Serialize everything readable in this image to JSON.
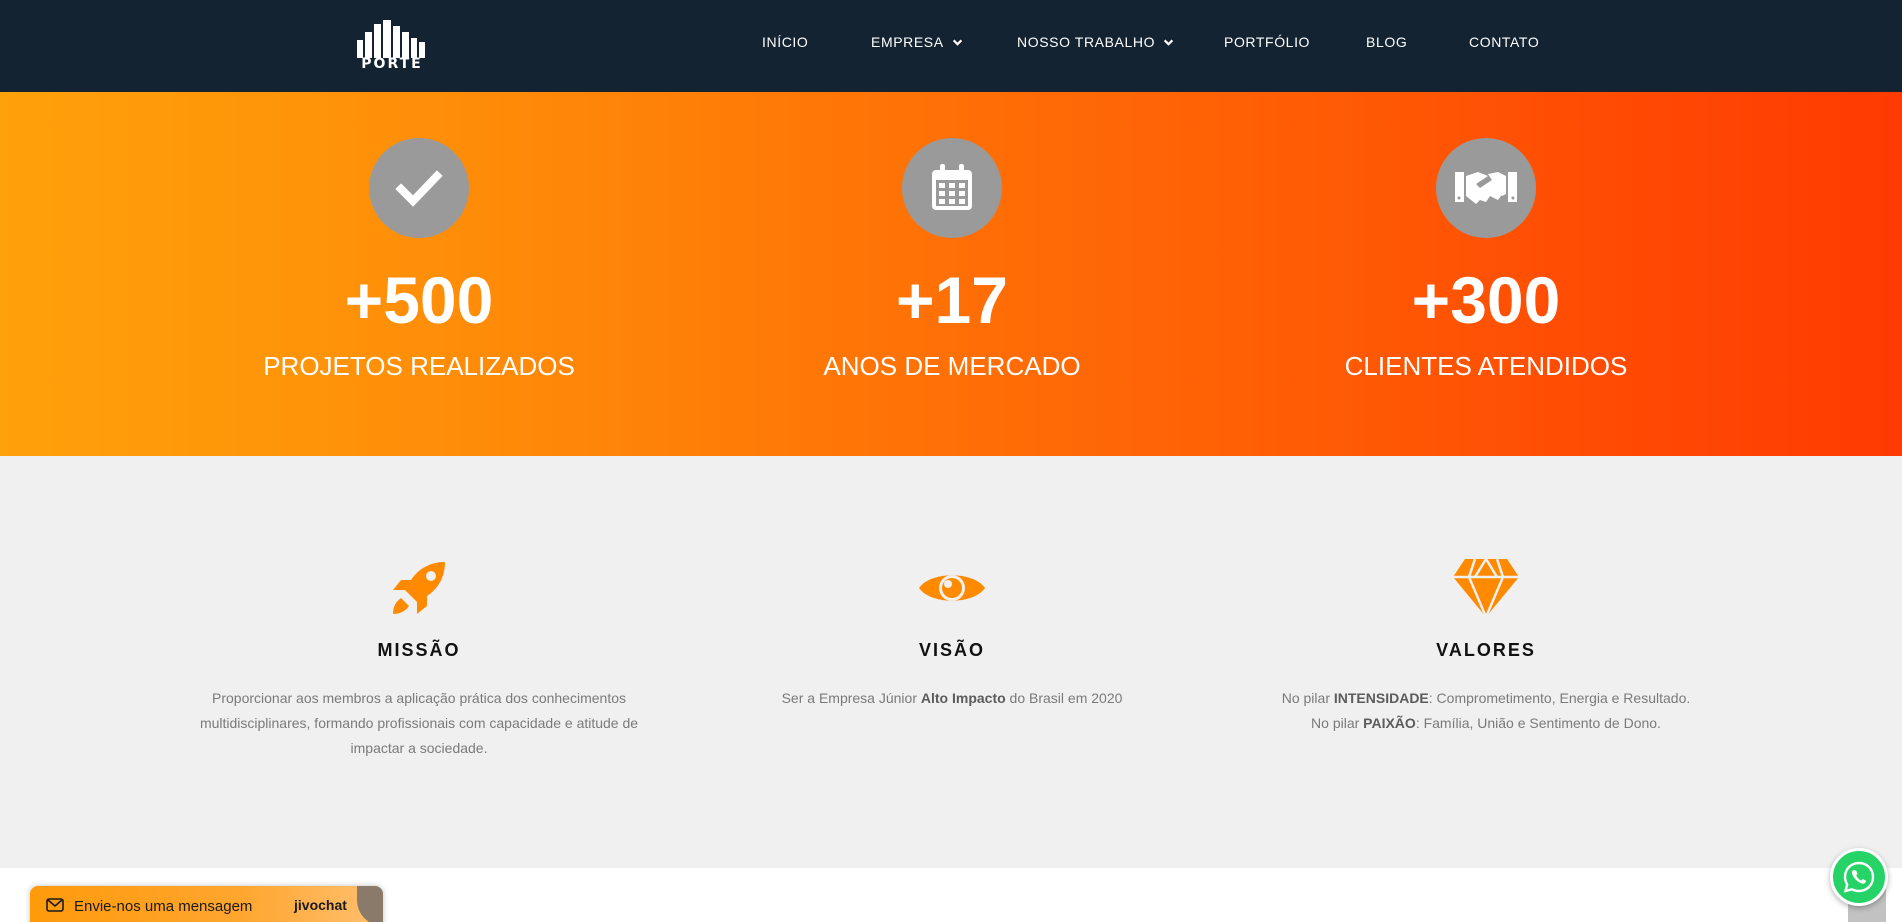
{
  "header": {
    "logo_text": "PORTE",
    "nav": [
      {
        "label": "INÍCIO",
        "has_dropdown": false
      },
      {
        "label": "EMPRESA",
        "has_dropdown": true
      },
      {
        "label": "NOSSO TRABALHO",
        "has_dropdown": true
      },
      {
        "label": "PORTFÓLIO",
        "has_dropdown": false
      },
      {
        "label": "BLOG",
        "has_dropdown": false
      },
      {
        "label": "CONTATO",
        "has_dropdown": false
      }
    ]
  },
  "stats": [
    {
      "icon": "check-icon",
      "number": "+500",
      "label": "PROJETOS REALIZADOS"
    },
    {
      "icon": "calendar-icon",
      "number": "+17",
      "label": "ANOS DE MERCADO"
    },
    {
      "icon": "handshake-icon",
      "number": "+300",
      "label": "CLIENTES ATENDIDOS"
    }
  ],
  "mvv": {
    "mission": {
      "icon": "rocket-icon",
      "title": "MISSÃO",
      "text": "Proporcionar aos membros a aplicação prática dos conhecimentos multidisciplinares, formando profissionais com capacidade e atitude de impactar a sociedade."
    },
    "vision": {
      "icon": "eye-icon",
      "title": "VISÃO",
      "text_before": "Ser a Empresa Júnior ",
      "text_bold": "Alto Impacto",
      "text_after": " do Brasil em 2020"
    },
    "values": {
      "icon": "diamond-icon",
      "title": "VALORES",
      "line1_before": "No pilar ",
      "line1_bold": "INTENSIDADE",
      "line1_after": ": Comprometimento, Energia e Resultado.",
      "line2_before": "No pilar ",
      "line2_bold": "PAIXÃO",
      "line2_after": ": Família, União e Sentimento de Dono."
    }
  },
  "chat": {
    "message": "Envie-nos uma mensagem",
    "brand": "jivochat"
  },
  "colors": {
    "header_bg": "#132332",
    "accent_orange": "#ff8a00",
    "gray_circle": "#9a9a9a",
    "section_bg": "#f0f0f0",
    "whatsapp": "#25d366"
  }
}
